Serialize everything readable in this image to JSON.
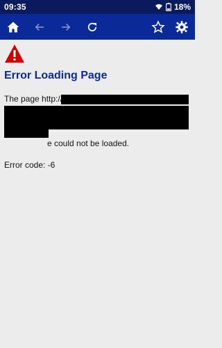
{
  "status": {
    "time": "09:35",
    "battery": "18%"
  },
  "toolbar": {
    "home_icon": "home-icon",
    "back_icon": "arrow-left-icon",
    "forward_icon": "arrow-right-icon",
    "reload_icon": "reload-icon",
    "bookmark_icon": "star-icon",
    "settings_icon": "gear-icon",
    "bg": "#0a2a9a"
  },
  "page": {
    "title": "Error Loading Page",
    "line1": "The page http://",
    "line_end": "e could not be loaded.",
    "error_code": "Error code: -6"
  },
  "colors": {
    "title": "#0a2a9a",
    "warning": "#d40000",
    "statusbar": "#0a1a5c"
  }
}
